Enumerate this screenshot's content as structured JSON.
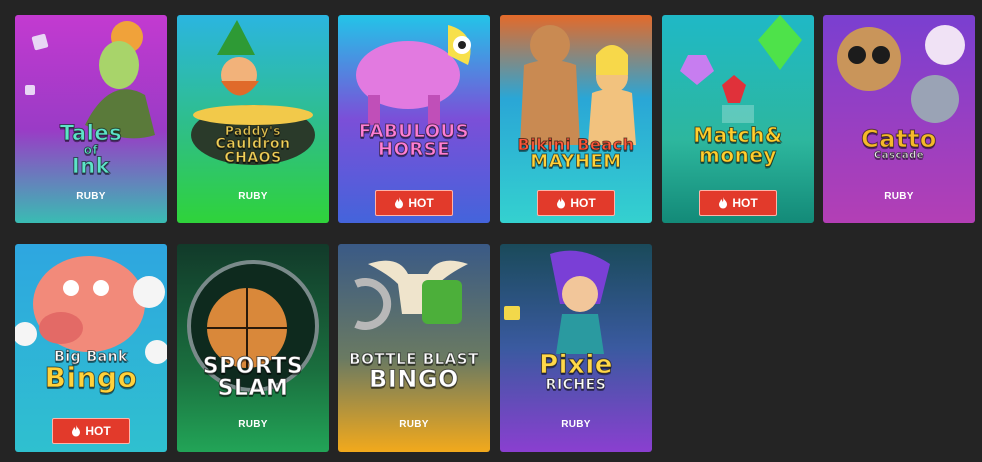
{
  "colors": {
    "page_bg": "#242424",
    "hot_badge": "#e23a2b"
  },
  "games": [
    {
      "id": "tales-of-ink",
      "logo_lines": [
        "Tales",
        "of",
        "Ink"
      ],
      "tag": "RUBY",
      "hot": false,
      "colors": [
        "#b02cc4",
        "#3fb9b2"
      ],
      "logo_color": "#5ee3c9",
      "icon": "sprite-girl-icon"
    },
    {
      "id": "paddys-cauldron-chaos",
      "logo_lines": [
        "Paddy's",
        "Cauldron",
        "CHAOS"
      ],
      "tag": "RUBY",
      "hot": false,
      "colors": [
        "#2fb7d6",
        "#2fcf3b"
      ],
      "logo_color": "#f2d25a",
      "icon": "leprechaun-icon"
    },
    {
      "id": "fabulous-horse",
      "logo_lines": [
        "FABULOUS",
        "HORSE"
      ],
      "tag": "HOT",
      "hot": true,
      "colors": [
        "#7b4fd8",
        "#4a6ae0"
      ],
      "logo_color": "#ff7fd6",
      "icon": "unicorn-icon"
    },
    {
      "id": "bikini-beach-mayhem",
      "logo_lines": [
        "Bikini Beach",
        "MAYHEM"
      ],
      "tag": "HOT",
      "hot": true,
      "colors": [
        "#3fc6e6",
        "#34d1cf"
      ],
      "logo_color": "#ff5a3c",
      "icon": "beach-couple-icon"
    },
    {
      "id": "match-and-money",
      "logo_lines": [
        "Match&",
        "money"
      ],
      "tag": "HOT",
      "hot": true,
      "colors": [
        "#2db79e",
        "#169a86"
      ],
      "logo_color": "#ffcf2e",
      "icon": "gems-icon"
    },
    {
      "id": "catto-cascade",
      "logo_lines": [
        "Catto",
        "Cascade"
      ],
      "tag": "RUBY",
      "hot": false,
      "colors": [
        "#8d3fd0",
        "#b33fb5"
      ],
      "logo_color": "#f5b82b",
      "icon": "cats-icon"
    },
    {
      "id": "big-bank-bingo",
      "logo_lines": [
        "Big Bank",
        "Bingo"
      ],
      "tag": "HOT",
      "hot": true,
      "colors": [
        "#3db7e0",
        "#2fc0cf"
      ],
      "logo_color": "#ffd23b",
      "icon": "piggy-bank-icon"
    },
    {
      "id": "sports-slam",
      "logo_lines": [
        "SPORTS",
        "SLAM"
      ],
      "tag": "RUBY",
      "hot": false,
      "colors": [
        "#0d3b2a",
        "#1f9e52"
      ],
      "logo_color": "#ffffff",
      "icon": "basketball-icon"
    },
    {
      "id": "bottle-blast-bingo",
      "logo_lines": [
        "BOTTLE BLAST",
        "BINGO"
      ],
      "tag": "RUBY",
      "hot": false,
      "colors": [
        "#3a5a7a",
        "#f2a91c"
      ],
      "logo_color": "#ffffff",
      "icon": "bull-skull-icon"
    },
    {
      "id": "pixie-riches",
      "logo_lines": [
        "Pixie",
        "RICHES"
      ],
      "tag": "RUBY",
      "hot": false,
      "colors": [
        "#1f6b74",
        "#8a3fd0"
      ],
      "logo_color": "#ffd84a",
      "icon": "pixie-icon"
    }
  ]
}
